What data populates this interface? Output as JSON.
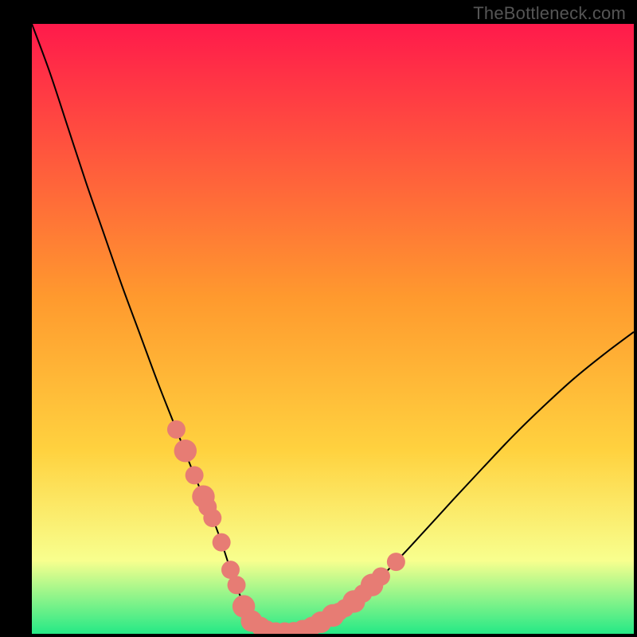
{
  "watermark": "TheBottleneck.com",
  "chart_data": {
    "type": "line",
    "title": "",
    "xlabel": "",
    "ylabel": "",
    "xlim": [
      0,
      100
    ],
    "ylim": [
      0,
      100
    ],
    "background_gradient": {
      "top_color": "#ff1a4b",
      "mid_color": "#ffd23f",
      "lower_color": "#f8ff8e",
      "bottom_color": "#25e986"
    },
    "series": [
      {
        "name": "bottleneck-curve",
        "x": [
          0,
          3,
          6,
          9,
          12,
          15,
          18,
          21,
          24,
          27,
          30,
          31.5,
          33,
          34.5,
          36,
          38,
          40,
          44,
          48,
          52,
          56,
          60,
          65,
          70,
          75,
          80,
          85,
          90,
          95,
          100
        ],
        "y": [
          100,
          92,
          83,
          74,
          65.5,
          57,
          49,
          41,
          33.5,
          26,
          19,
          15,
          10.5,
          6.5,
          3.3,
          1.2,
          0.3,
          0.4,
          1.8,
          4.2,
          7.5,
          11.3,
          16.6,
          22,
          27.3,
          32.5,
          37.3,
          41.8,
          45.8,
          49.5
        ]
      }
    ],
    "markers": {
      "name": "highlighted-points",
      "color": "#e77c74",
      "points": [
        {
          "x": 24.0,
          "y": 33.5,
          "r": 1.1
        },
        {
          "x": 25.5,
          "y": 30.0,
          "r": 1.5
        },
        {
          "x": 27.0,
          "y": 26.0,
          "r": 1.1
        },
        {
          "x": 28.5,
          "y": 22.5,
          "r": 1.5
        },
        {
          "x": 29.2,
          "y": 20.8,
          "r": 1.1
        },
        {
          "x": 30.0,
          "y": 19.0,
          "r": 1.1
        },
        {
          "x": 31.5,
          "y": 15.0,
          "r": 1.1
        },
        {
          "x": 33.0,
          "y": 10.5,
          "r": 1.1
        },
        {
          "x": 34.0,
          "y": 8.0,
          "r": 1.1
        },
        {
          "x": 35.2,
          "y": 4.5,
          "r": 1.5
        },
        {
          "x": 36.5,
          "y": 2.1,
          "r": 1.4
        },
        {
          "x": 38.0,
          "y": 1.2,
          "r": 1.2
        },
        {
          "x": 39.0,
          "y": 0.6,
          "r": 1.2
        },
        {
          "x": 40.5,
          "y": 0.3,
          "r": 1.2
        },
        {
          "x": 42.0,
          "y": 0.3,
          "r": 1.2
        },
        {
          "x": 43.5,
          "y": 0.35,
          "r": 1.2
        },
        {
          "x": 45.0,
          "y": 0.7,
          "r": 1.2
        },
        {
          "x": 46.5,
          "y": 1.2,
          "r": 1.2
        },
        {
          "x": 48.0,
          "y": 1.9,
          "r": 1.4
        },
        {
          "x": 50.0,
          "y": 3.0,
          "r": 1.5
        },
        {
          "x": 51.0,
          "y": 3.6,
          "r": 1.1
        },
        {
          "x": 52.0,
          "y": 4.2,
          "r": 1.1
        },
        {
          "x": 53.5,
          "y": 5.3,
          "r": 1.5
        },
        {
          "x": 55.0,
          "y": 6.6,
          "r": 1.1
        },
        {
          "x": 56.5,
          "y": 8.0,
          "r": 1.5
        },
        {
          "x": 58.0,
          "y": 9.4,
          "r": 1.1
        },
        {
          "x": 60.5,
          "y": 11.8,
          "r": 1.1
        }
      ]
    }
  }
}
